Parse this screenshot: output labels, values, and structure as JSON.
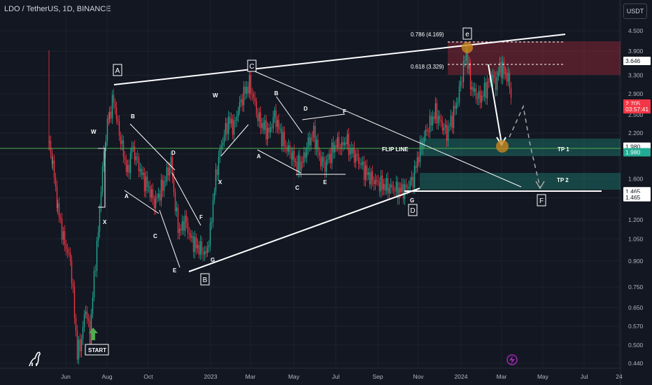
{
  "header": {
    "symbol": "LDO / TetherUS, 1D, BINANCE",
    "currency": "USDT"
  },
  "chart_data": {
    "type": "candlestick",
    "y_scale": "log",
    "y_ticks": [
      "4.500",
      "3.900",
      "3.300",
      "2.900",
      "2.500",
      "2.200",
      "1.900",
      "1.600",
      "1.400",
      "1.200",
      "1.050",
      "0.900",
      "0.750",
      "0.650",
      "0.570",
      "0.500",
      "0.440"
    ],
    "x_ticks": [
      "Jun",
      "Aug",
      "Oct",
      "2023",
      "Mar",
      "May",
      "Jul",
      "Sep",
      "Nov",
      "2024",
      "Mar",
      "May",
      "Jul",
      "24"
    ],
    "price_labels": [
      {
        "text": "3.646",
        "value": 3.646,
        "bg": "#ffffff",
        "fg": "#131722"
      },
      {
        "text": "2.705",
        "value": 2.705,
        "bg": "#f23645",
        "fg": "#ffffff"
      },
      {
        "text": "03:57:41",
        "value": 2.6,
        "bg": "#f23645",
        "fg": "#ffffff"
      },
      {
        "text": "1.980",
        "value": 2.0,
        "bg": "#ffffff",
        "fg": "#131722"
      },
      {
        "text": "1.980",
        "value": 1.925,
        "bg": "#22ab94",
        "fg": "#ffffff"
      },
      {
        "text": "1.465",
        "value": 1.465,
        "bg": "#ffffff",
        "fg": "#131722"
      },
      {
        "text": "1.465",
        "value": 1.405,
        "bg": "#ffffff",
        "fg": "#131722"
      }
    ],
    "fib_levels": [
      {
        "text": "0.786 (4.169)",
        "value": 4.169
      },
      {
        "text": "0.618 (3.329)",
        "value": 3.329
      }
    ],
    "annotations": {
      "flip_line": "FLIP LINE",
      "tp1": "TP 1",
      "tp2": "TP 2",
      "start": "START",
      "boxed": [
        "A",
        "C",
        "B",
        "D",
        "e",
        "F"
      ],
      "waves": [
        "W",
        "X",
        "A",
        "B",
        "C",
        "D",
        "E",
        "F",
        "G",
        "W",
        "X",
        "A",
        "B",
        "C",
        "D",
        "E",
        "F",
        "G"
      ]
    },
    "levels": {
      "flip": 1.98,
      "support": 1.465,
      "tp1_zone": [
        1.9,
        2.1
      ],
      "tp2_zone": [
        1.47,
        1.65
      ],
      "resistance_zone": [
        3.2,
        4.2
      ]
    }
  }
}
